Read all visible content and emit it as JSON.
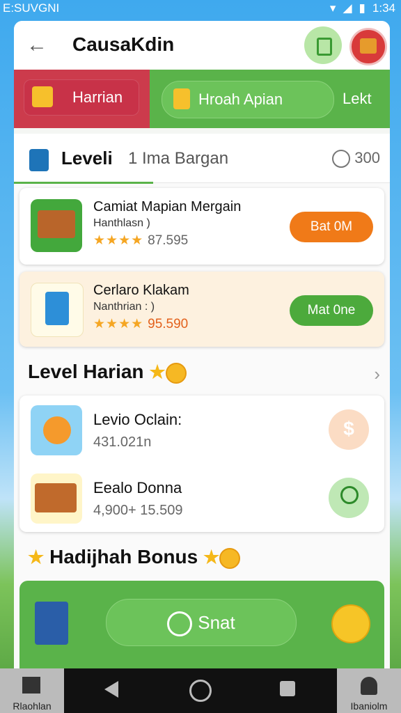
{
  "status_bar": {
    "left_text": "E:SUVGNI",
    "time": "1:34"
  },
  "header": {
    "title": "CausaKdin"
  },
  "tabs": [
    {
      "label": "Harrian"
    },
    {
      "label": "Hroah Apian"
    },
    {
      "label": "Lekt"
    }
  ],
  "level_header": {
    "title": "Leveli",
    "subtitle": "1 Ima Bargan",
    "right_value": "300"
  },
  "offers": [
    {
      "title": "Camiat Mapian Mergain",
      "subtitle": "Hanthlasn )",
      "stars": "★★★★",
      "rating_value": "87.595",
      "button": "Bat 0M"
    },
    {
      "title": "Cerlaro Klakam",
      "subtitle": "Nanthrian : )",
      "stars": "★★★★",
      "rating_value": "95.590",
      "button": "Mat 0ne"
    }
  ],
  "level_harian": {
    "title": "Level Harian",
    "items": [
      {
        "title": "Levio Oclain:",
        "value": "431.021n",
        "action": "$"
      },
      {
        "title": "Eealo Donna",
        "value": "4,900+ 15.509"
      }
    ]
  },
  "bonus": {
    "title": "Hadijhah Bonus",
    "button": "Snat"
  },
  "bottom_nav": {
    "left_label": "Rlaohlan",
    "right_label": "Ibaniolm"
  }
}
